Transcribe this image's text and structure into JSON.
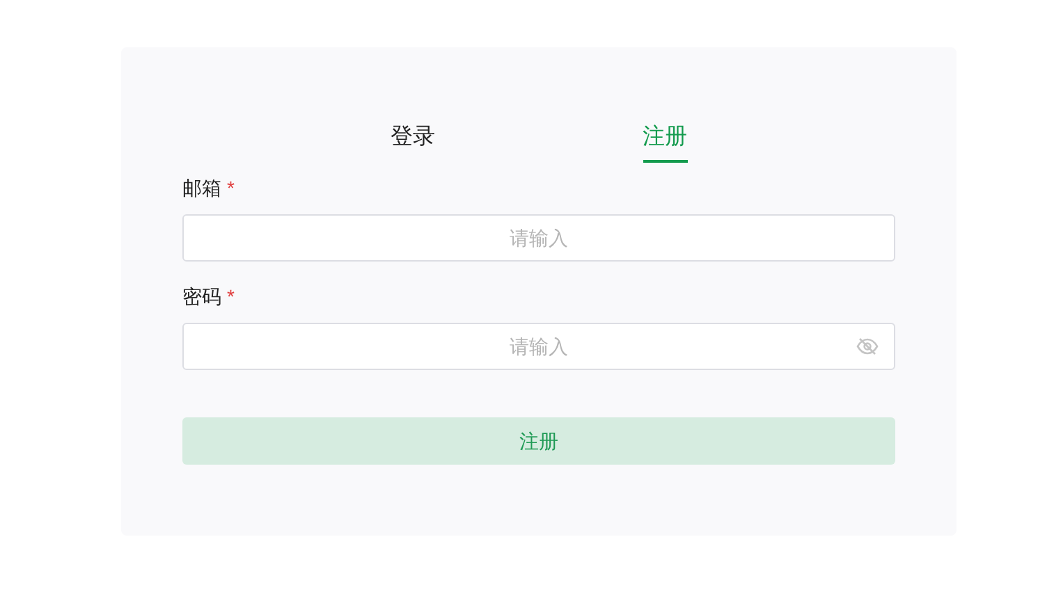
{
  "tabs": [
    {
      "label": "登录",
      "selected": false
    },
    {
      "label": "注册",
      "selected": true
    }
  ],
  "fields": [
    {
      "label": "邮箱",
      "required_mark": "*",
      "placeholder": "请输入",
      "kind": "text"
    },
    {
      "label": "密码",
      "required_mark": "*",
      "placeholder": "请输入",
      "kind": "password"
    }
  ],
  "submit": {
    "label": "注册",
    "disabled": true
  }
}
